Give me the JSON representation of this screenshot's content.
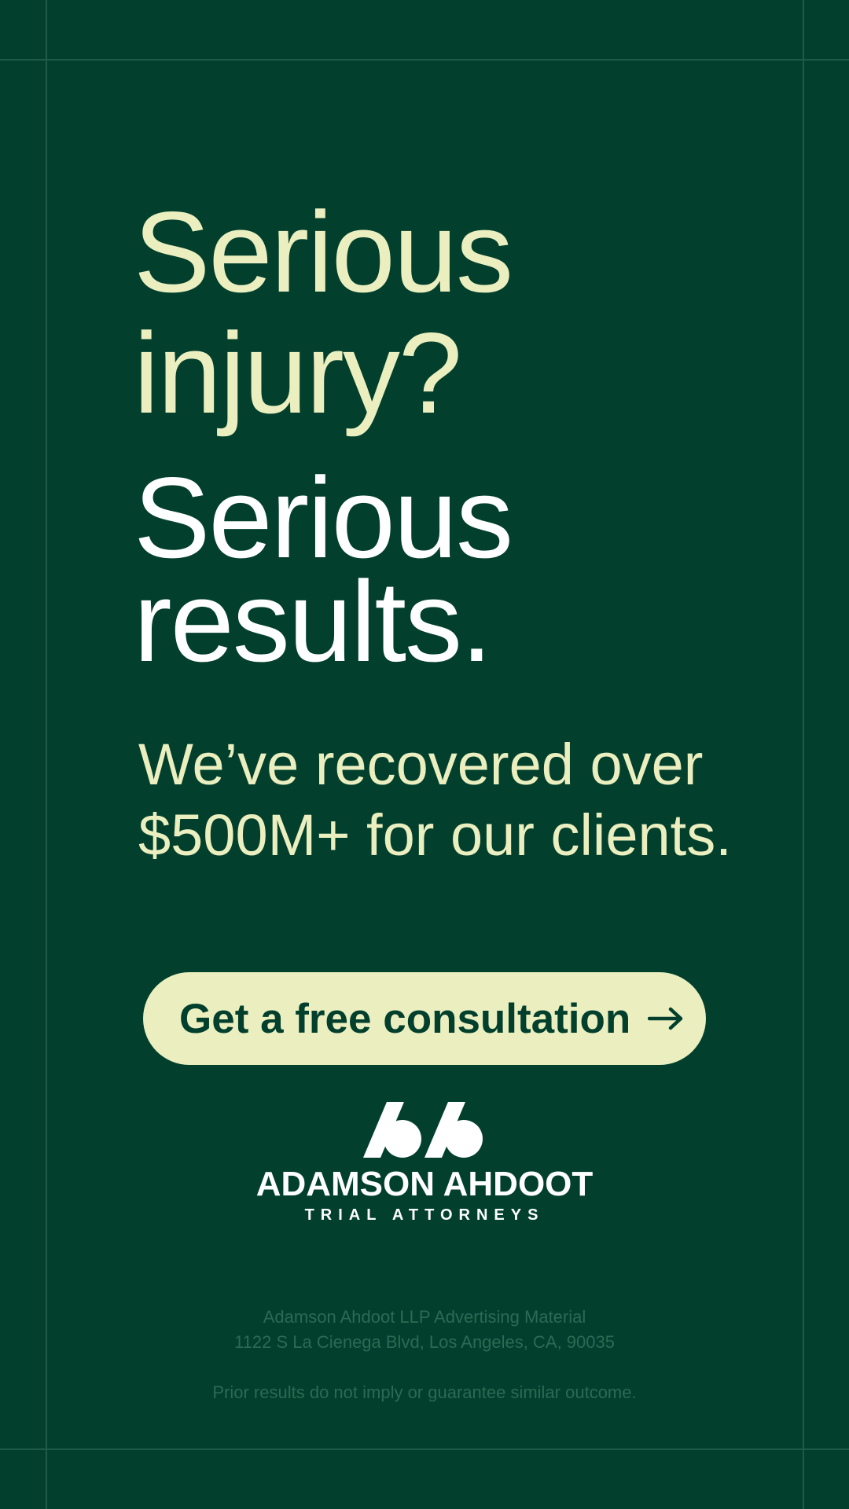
{
  "colors": {
    "background": "#02402d",
    "accent_cream": "#ebefc0",
    "white": "#ffffff",
    "guide": "#1f5a47",
    "legal_text": "#2d6a55"
  },
  "headline": {
    "question_line1": "Serious",
    "question_line2": "injury?",
    "answer_line1": "Serious",
    "answer_line2": "results."
  },
  "subhead": {
    "line1": "We’ve recovered over",
    "line2": "$500M+ for our clients."
  },
  "cta": {
    "label": "Get a free consultation",
    "icon": "arrow-right-icon"
  },
  "logo": {
    "icon": "adamson-ahdoot-logo-icon",
    "name": "ADAMSON AHDOOT",
    "tagline": "TRIAL ATTORNEYS"
  },
  "legal": {
    "line1": "Adamson Ahdoot LLP Advertising Material",
    "line2": "1122 S La Cienega Blvd, Los Angeles, CA, 90035",
    "disclaimer": "Prior results do not imply or guarantee similar outcome."
  }
}
